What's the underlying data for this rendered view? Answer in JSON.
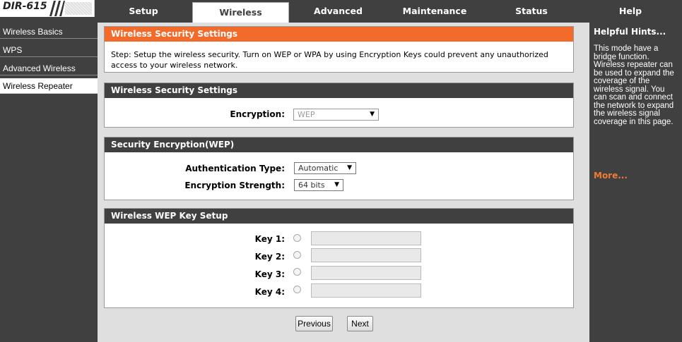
{
  "brand": {
    "model": "DIR-615"
  },
  "nav_tabs": [
    {
      "label": "Setup"
    },
    {
      "label": "Wireless"
    },
    {
      "label": "Advanced"
    },
    {
      "label": "Maintenance"
    },
    {
      "label": "Status"
    },
    {
      "label": "Help"
    }
  ],
  "active_tab": "Wireless",
  "sidebar": {
    "items": [
      {
        "label": "Wireless Basics"
      },
      {
        "label": "WPS"
      },
      {
        "label": "Advanced Wireless"
      },
      {
        "label": "Wireless Repeater"
      }
    ],
    "active": "Wireless Repeater"
  },
  "intro": {
    "title": "Wireless Security Settings",
    "description": "Step: Setup the wireless security. Turn on WEP or WPA by using Encryption Keys could prevent any unauthorized access to your wireless network."
  },
  "security": {
    "title": "Wireless Security Settings",
    "encryption_label": "Encryption:",
    "encryption_value": "WEP"
  },
  "wep": {
    "title": "Security Encryption(WEP)",
    "auth_label": "Authentication Type:",
    "auth_value": "Automatic",
    "strength_label": "Encryption Strength:",
    "strength_value": "64 bits"
  },
  "keys": {
    "title": "Wireless WEP Key Setup",
    "items": [
      {
        "label": "Key 1:",
        "value": ""
      },
      {
        "label": "Key 2:",
        "value": ""
      },
      {
        "label": "Key 3:",
        "value": ""
      },
      {
        "label": "Key 4:",
        "value": ""
      }
    ]
  },
  "buttons": {
    "previous": "Previous",
    "next": "Next"
  },
  "hints": {
    "title": "Helpful Hints...",
    "body": "This mode have a bridge function. Wireless repeater can be used to expand the coverage of the wireless signal. You can scan and connect the network to expand the wireless signal coverage in this page.",
    "more": "More..."
  },
  "colors": {
    "header_orange": "#f26b2b",
    "dark": "#404040",
    "link_orange": "#f07c34"
  }
}
